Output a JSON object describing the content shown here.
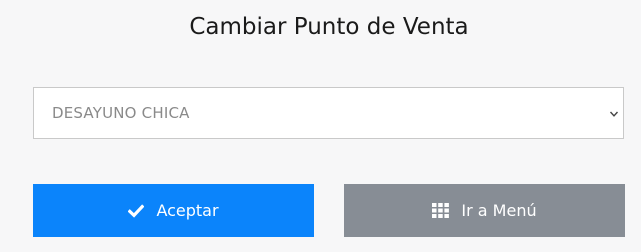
{
  "page": {
    "title": "Cambiar Punto de Venta"
  },
  "point_of_sale_select": {
    "selected_value": "DESAYUNO CHICA",
    "icon": "chevron-down-icon"
  },
  "buttons": {
    "accept_label": "Aceptar",
    "accept_icon": "check-icon",
    "accept_color": "#0b84fb",
    "menu_label": "Ir a Menú",
    "menu_icon": "grid-icon",
    "menu_color": "#878d95"
  }
}
